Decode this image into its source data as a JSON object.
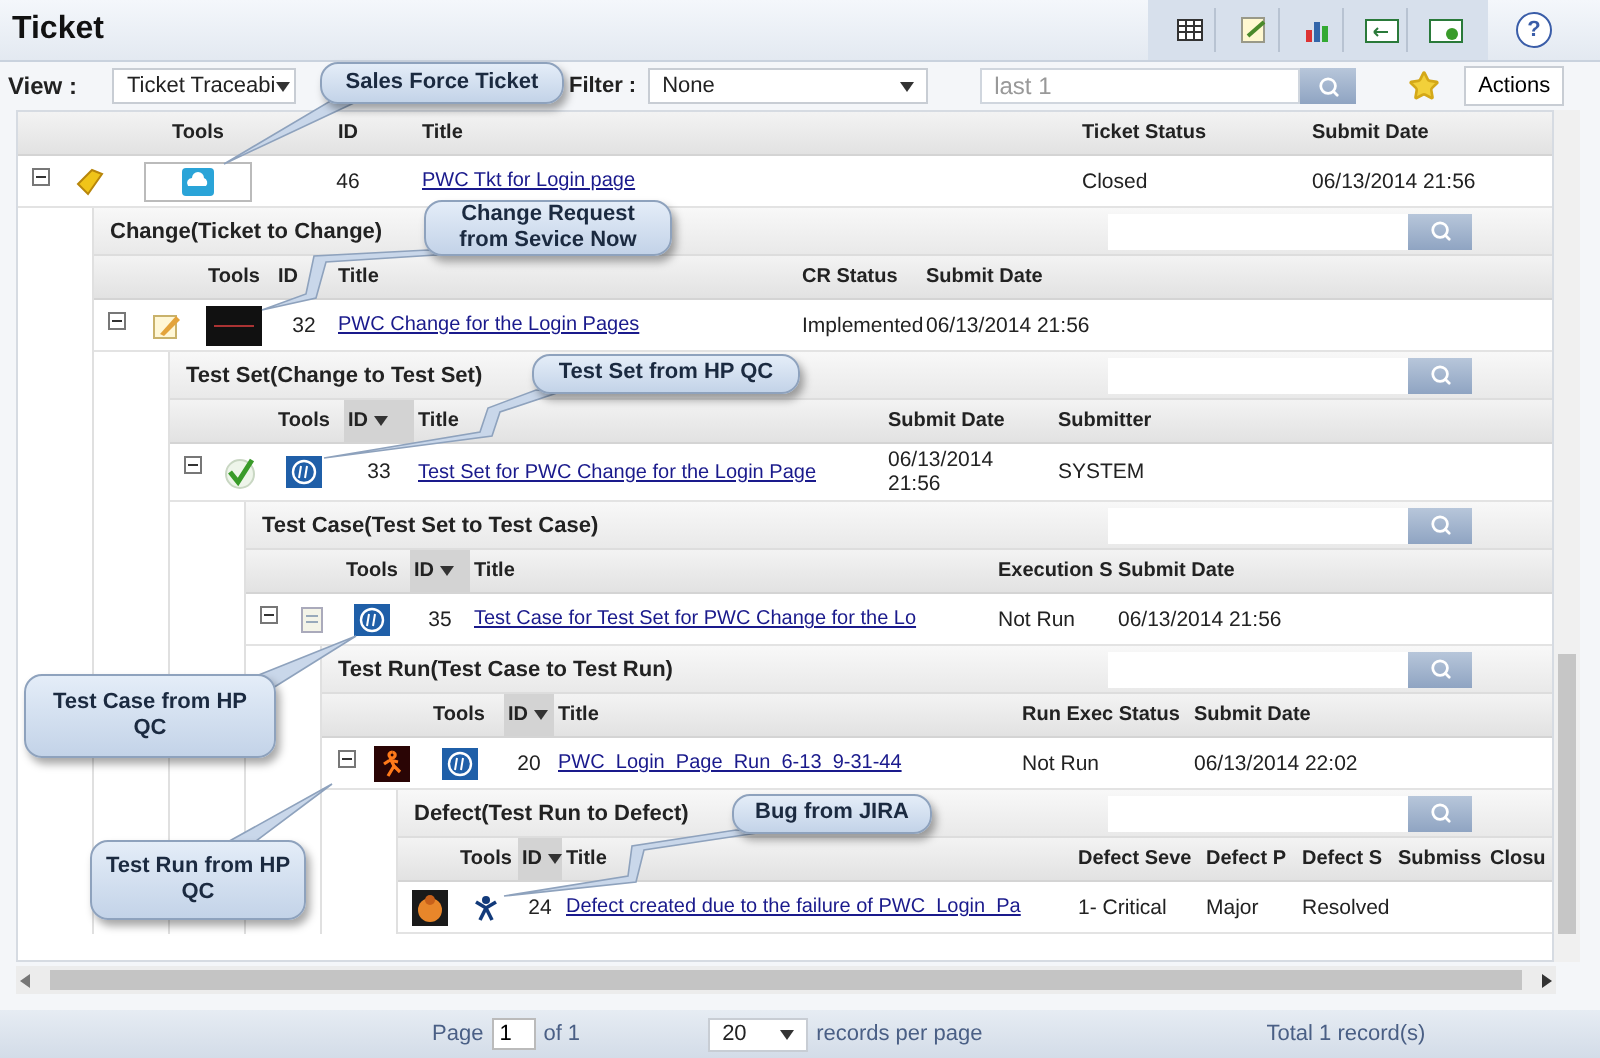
{
  "header": {
    "title": "Ticket",
    "help_label": "?"
  },
  "view_bar": {
    "view_label": "View :",
    "view_value": "Ticket Traceabi",
    "filter_label": "Filter :",
    "filter_value": "None",
    "search_placeholder": "last 1",
    "actions_label": "Actions"
  },
  "grid": {
    "expanded": true,
    "columns": [
      {
        "label": "Tools",
        "sorted": false
      },
      {
        "label": "ID",
        "sorted": false
      },
      {
        "label": "Title",
        "sorted": false
      },
      {
        "label": "Ticket Status",
        "sorted": false
      },
      {
        "label": "Submit Date",
        "sorted": false
      }
    ],
    "row": {
      "id": "46",
      "title": "PWC Tkt for Login page",
      "values": [
        "Closed",
        "06/13/2014 21:56"
      ]
    },
    "children": [
      {
        "title": "Change(Ticket to Change)",
        "expanded": true,
        "columns": [
          {
            "label": "Tools",
            "sorted": false
          },
          {
            "label": "ID",
            "sorted": false
          },
          {
            "label": "Title",
            "sorted": false
          },
          {
            "label": "CR Status",
            "sorted": false
          },
          {
            "label": "Submit Date",
            "sorted": false
          }
        ],
        "row": {
          "id": "32",
          "title": "PWC Change for the Login Pages",
          "values": [
            "Implemented",
            "06/13/2014 21:56"
          ]
        },
        "children": [
          {
            "title": "Test Set(Change to Test Set)",
            "expanded": true,
            "columns": [
              {
                "label": "Tools",
                "sorted": false
              },
              {
                "label": "ID",
                "sorted": true
              },
              {
                "label": "Title",
                "sorted": false
              },
              {
                "label": "Submit Date",
                "sorted": false
              },
              {
                "label": "Submitter",
                "sorted": false
              }
            ],
            "row": {
              "id": "33",
              "title": "Test Set for PWC Change for the Login Page",
              "values": [
                "06/13/2014 21:56",
                "SYSTEM"
              ]
            },
            "children": [
              {
                "title": "Test Case(Test Set to Test Case)",
                "expanded": true,
                "columns": [
                  {
                    "label": "Tools",
                    "sorted": false
                  },
                  {
                    "label": "ID",
                    "sorted": true
                  },
                  {
                    "label": "Title",
                    "sorted": false
                  },
                  {
                    "label": "Execution S",
                    "sorted": false
                  },
                  {
                    "label": "Submit Date",
                    "sorted": false
                  }
                ],
                "row": {
                  "id": "35",
                  "title": "Test Case for Test Set for PWC Change for the Lo",
                  "values": [
                    "Not Run",
                    "06/13/2014 21:56"
                  ]
                },
                "children": [
                  {
                    "title": "Test Run(Test Case to Test Run)",
                    "expanded": true,
                    "columns": [
                      {
                        "label": "Tools",
                        "sorted": false
                      },
                      {
                        "label": "ID",
                        "sorted": true
                      },
                      {
                        "label": "Title",
                        "sorted": false
                      },
                      {
                        "label": "Run Exec Status",
                        "sorted": false
                      },
                      {
                        "label": "Submit Date",
                        "sorted": false
                      }
                    ],
                    "row": {
                      "id": "20",
                      "title": "PWC_Login_Page_Run_6-13_9-31-44",
                      "values": [
                        "Not Run",
                        "06/13/2014 22:02"
                      ]
                    },
                    "children": [
                      {
                        "title": "Defect(Test Run to Defect)",
                        "columns": [
                          {
                            "label": "Tools",
                            "sorted": false
                          },
                          {
                            "label": "ID",
                            "sorted": true
                          },
                          {
                            "label": "Title",
                            "sorted": false
                          },
                          {
                            "label": "Defect Seve",
                            "sorted": false
                          },
                          {
                            "label": "Defect P",
                            "sorted": false
                          },
                          {
                            "label": "Defect S",
                            "sorted": false
                          },
                          {
                            "label": "Submiss",
                            "sorted": false
                          },
                          {
                            "label": "Closu",
                            "sorted": false
                          }
                        ],
                        "row": {
                          "id": "24",
                          "title": "Defect created due to the failure of PWC_Login_Pa",
                          "values": [
                            "1- Critical",
                            "Major",
                            "Resolved"
                          ]
                        }
                      }
                    ]
                  }
                ]
              }
            ]
          }
        ]
      }
    ]
  },
  "pager": {
    "page_label": "Page",
    "page_value": "1",
    "of_label": "of 1",
    "per_page_value": "20",
    "per_page_label": "records per page",
    "total": "Total 1 record(s)"
  },
  "callouts": [
    {
      "text": "Sales Force Ticket"
    },
    {
      "text": "Change Request from Sevice Now"
    },
    {
      "text": "Test Set from HP QC"
    },
    {
      "text": "Test Case from HP QC"
    },
    {
      "text": "Test Run from HP QC"
    },
    {
      "text": "Bug from JIRA"
    }
  ]
}
